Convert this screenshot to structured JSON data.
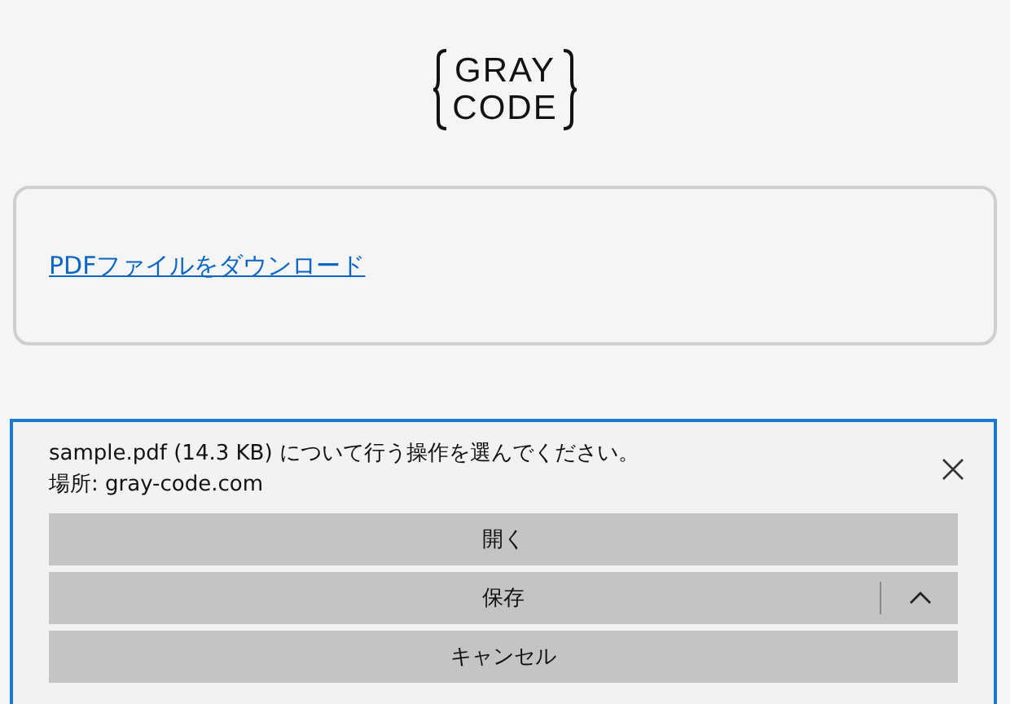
{
  "logo": {
    "lines": [
      "GRAY",
      "CODE"
    ]
  },
  "card": {
    "link": "PDFファイルをダウンロード"
  },
  "download_bar": {
    "message": "sample.pdf (14.3 KB) について行う操作を選んでください。",
    "source": "場所: gray-code.com",
    "buttons": [
      {
        "label": "開く",
        "kind": "plain"
      },
      {
        "label": "保存",
        "kind": "split"
      },
      {
        "label": "キャンセル",
        "kind": "plain"
      }
    ]
  }
}
